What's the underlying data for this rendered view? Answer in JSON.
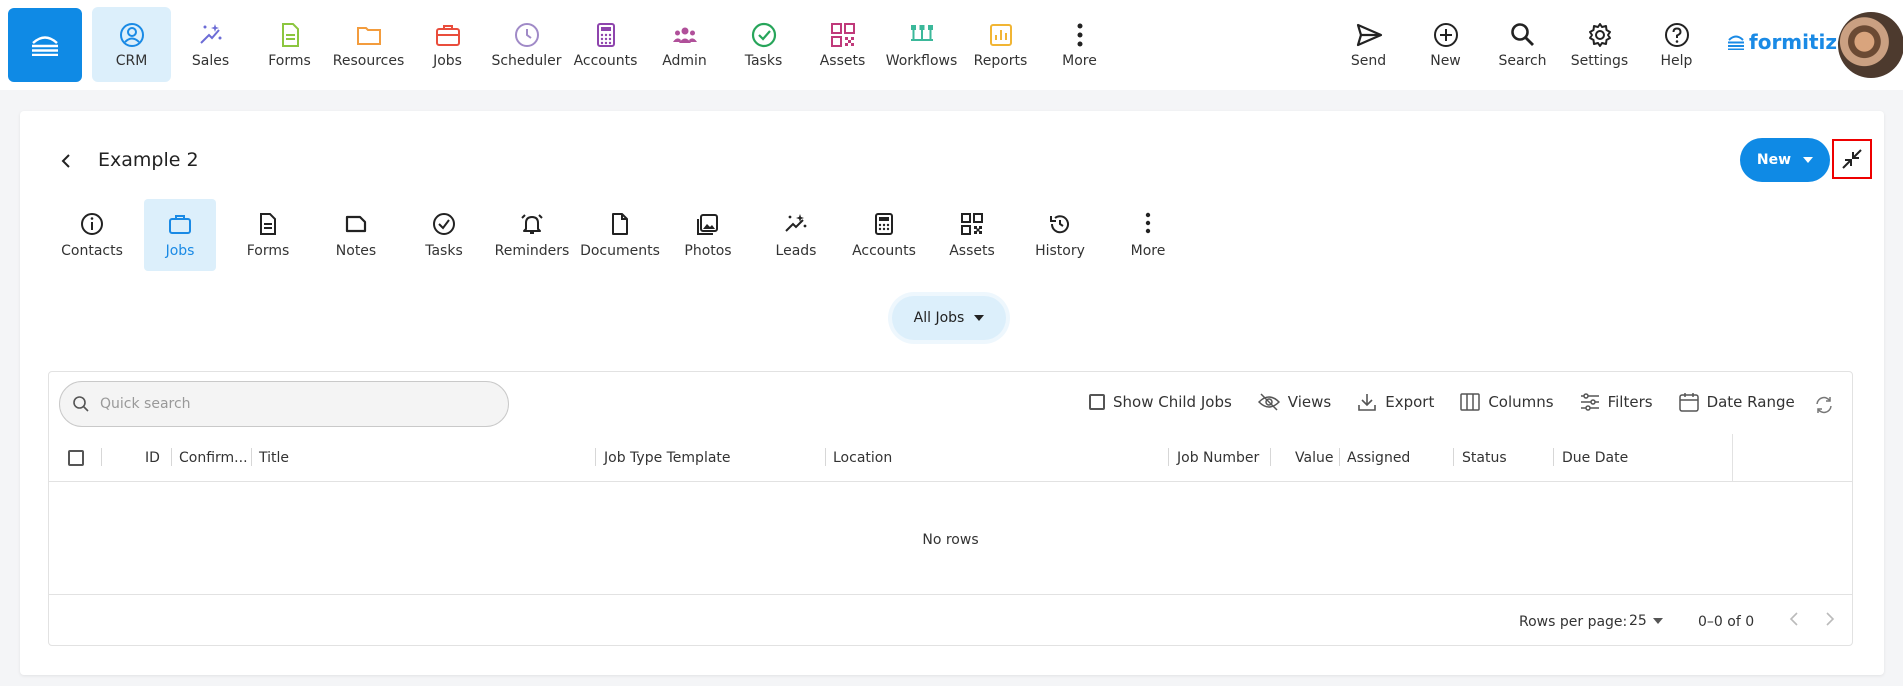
{
  "topnav": {
    "items": [
      {
        "label": "CRM",
        "icon": "user-circle-icon",
        "color": "#1a8ae5"
      },
      {
        "label": "Sales",
        "icon": "sparkles-icon",
        "color": "#6c6cd6"
      },
      {
        "label": "Forms",
        "icon": "document-icon",
        "color": "#8cc63f"
      },
      {
        "label": "Resources",
        "icon": "folder-icon",
        "color": "#f39c3d"
      },
      {
        "label": "Jobs",
        "icon": "briefcase-icon",
        "color": "#e94d3c"
      },
      {
        "label": "Scheduler",
        "icon": "clock-icon",
        "color": "#a08ac7"
      },
      {
        "label": "Accounts",
        "icon": "calculator-icon",
        "color": "#8e44ad"
      },
      {
        "label": "Admin",
        "icon": "users-icon",
        "color": "#b0509a"
      },
      {
        "label": "Tasks",
        "icon": "check-circle-icon",
        "color": "#27a55a"
      },
      {
        "label": "Assets",
        "icon": "qr-code-icon",
        "color": "#c0397a"
      },
      {
        "label": "Workflows",
        "icon": "workflow-icon",
        "color": "#3bb89a"
      },
      {
        "label": "Reports",
        "icon": "bar-chart-icon",
        "color": "#f1b534"
      },
      {
        "label": "More",
        "icon": "more-vertical-icon",
        "color": "#222222"
      }
    ],
    "right": [
      {
        "label": "Send",
        "icon": "send-icon"
      },
      {
        "label": "New",
        "icon": "plus-circle-icon"
      },
      {
        "label": "Search",
        "icon": "search-icon"
      },
      {
        "label": "Settings",
        "icon": "gear-icon"
      },
      {
        "label": "Help",
        "icon": "help-circle-icon"
      }
    ],
    "logo": "formitize"
  },
  "page": {
    "title": "Example 2",
    "new_label": "New",
    "tabs": [
      {
        "label": "Contacts",
        "icon": "info-icon"
      },
      {
        "label": "Jobs",
        "icon": "briefcase-icon"
      },
      {
        "label": "Forms",
        "icon": "document-icon"
      },
      {
        "label": "Notes",
        "icon": "note-icon"
      },
      {
        "label": "Tasks",
        "icon": "check-circle-icon"
      },
      {
        "label": "Reminders",
        "icon": "bell-icon"
      },
      {
        "label": "Documents",
        "icon": "file-icon"
      },
      {
        "label": "Photos",
        "icon": "image-icon"
      },
      {
        "label": "Leads",
        "icon": "sparkles-icon"
      },
      {
        "label": "Accounts",
        "icon": "calculator-icon"
      },
      {
        "label": "Assets",
        "icon": "qr-code-icon"
      },
      {
        "label": "History",
        "icon": "history-icon"
      },
      {
        "label": "More",
        "icon": "more-vertical-icon"
      }
    ],
    "filter_label": "All Jobs"
  },
  "grid": {
    "search_placeholder": "Quick search",
    "toolbar": {
      "show_child_jobs": "Show Child Jobs",
      "views": "Views",
      "export": "Export",
      "columns": "Columns",
      "filters": "Filters",
      "date_range": "Date Range"
    },
    "columns": [
      "ID",
      "Confirm...",
      "Title",
      "Job Type Template",
      "Location",
      "Job Number",
      "Value",
      "Assigned",
      "Status",
      "Due Date"
    ],
    "empty_text": "No rows",
    "rows_per_page_label": "Rows per page:",
    "rows_per_page": "25",
    "range_text": "0–0 of 0"
  },
  "colors": {
    "accent": "#0f8ae5",
    "active_bg": "#dceffb"
  }
}
